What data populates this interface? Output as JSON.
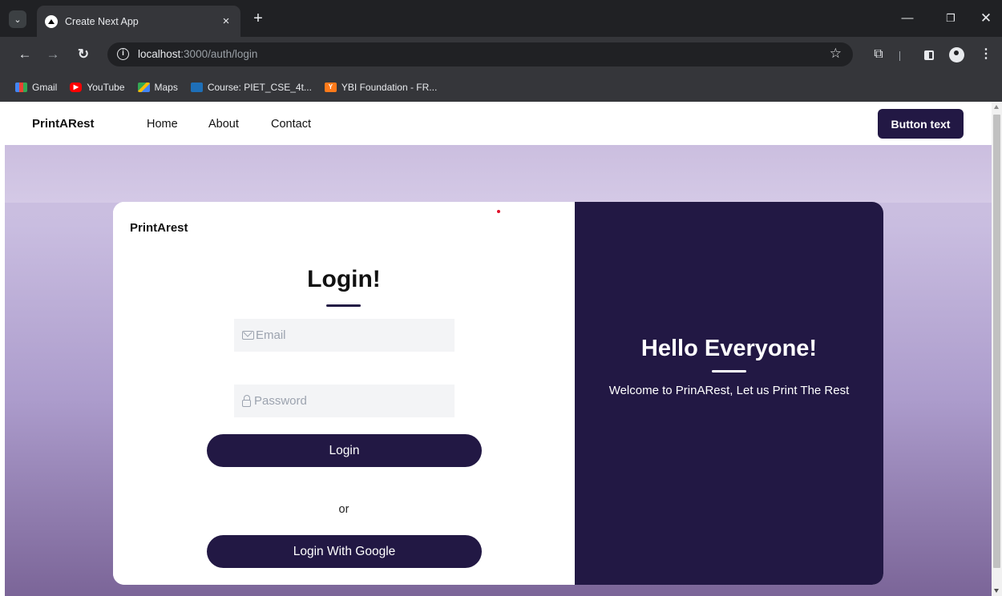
{
  "browser": {
    "tab_title": "Create Next App",
    "tab_close": "×",
    "new_tab": "+",
    "url_host": "localhost",
    "url_path": ":3000/auth/login",
    "bookmarks": [
      {
        "label": "Gmail",
        "icon": "gmail-icon"
      },
      {
        "label": "YouTube",
        "icon": "youtube-icon"
      },
      {
        "label": "Maps",
        "icon": "maps-icon"
      },
      {
        "label": "Course: PIET_CSE_4t...",
        "icon": "cisco-icon"
      },
      {
        "label": "YBI Foundation - FR...",
        "icon": "ybi-icon"
      }
    ]
  },
  "navbar": {
    "brand": "PrintARest",
    "links": [
      "Home",
      "About",
      "Contact"
    ],
    "cta_label": "Button text"
  },
  "login": {
    "brand": "PrintArest",
    "title": "Login!",
    "email_placeholder": "Email",
    "password_placeholder": "Password",
    "login_button": "Login",
    "or_text": "or",
    "google_button": "Login With Google"
  },
  "welcome": {
    "title": "Hello Everyone!",
    "text": "Welcome to PrinARest, Let us Print The Rest"
  },
  "colors": {
    "accent": "#221844",
    "background_top": "#cfc3e3",
    "background_bottom": "#7b6598",
    "field_bg": "#f3f4f6"
  }
}
